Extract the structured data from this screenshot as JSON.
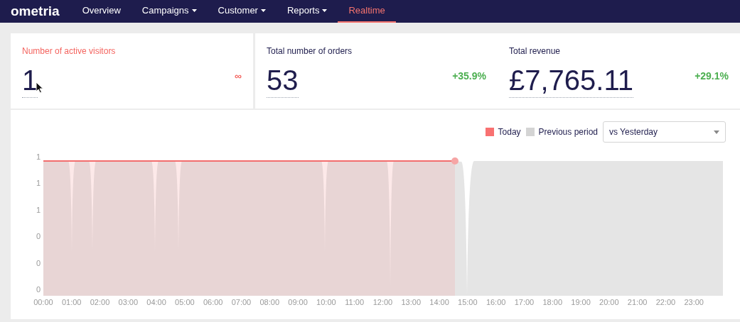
{
  "nav": {
    "logo": "ometria",
    "items": [
      {
        "label": "Overview",
        "has_dropdown": false,
        "selected": false
      },
      {
        "label": "Campaigns",
        "has_dropdown": true,
        "selected": false
      },
      {
        "label": "Customer",
        "has_dropdown": true,
        "selected": false
      },
      {
        "label": "Reports",
        "has_dropdown": true,
        "selected": false
      },
      {
        "label": "Realtime",
        "has_dropdown": false,
        "selected": true
      }
    ]
  },
  "stats": [
    {
      "label": "Number of active visitors",
      "value": "1",
      "change": "∞",
      "color": "#f4645f",
      "selected": true
    },
    {
      "label": "Total number of orders",
      "value": "53",
      "change": "+35.9%",
      "color": "#4caf50",
      "selected": false
    },
    {
      "label": "Total revenue",
      "value": "£7,765.11",
      "change": "+29.1%",
      "color": "#4caf50",
      "selected": false
    }
  ],
  "chart": {
    "legend": [
      {
        "label": "Today",
        "color": "#f87171"
      },
      {
        "label": "Previous period",
        "color": "#d4d4d4"
      }
    ],
    "comparison": "vs Yesterday",
    "y_axis_labels": [
      "1",
      "1",
      "1",
      "0",
      "0",
      "0"
    ],
    "x_axis_labels": [
      "00:00",
      "01:00",
      "02:00",
      "03:00",
      "04:00",
      "05:00",
      "06:00",
      "07:00",
      "08:00",
      "09:00",
      "10:00",
      "11:00",
      "12:00",
      "13:00",
      "14:00",
      "15:00",
      "16:00",
      "17:00",
      "18:00",
      "19:00",
      "20:00",
      "21:00",
      "22:00",
      "23:00"
    ]
  }
}
